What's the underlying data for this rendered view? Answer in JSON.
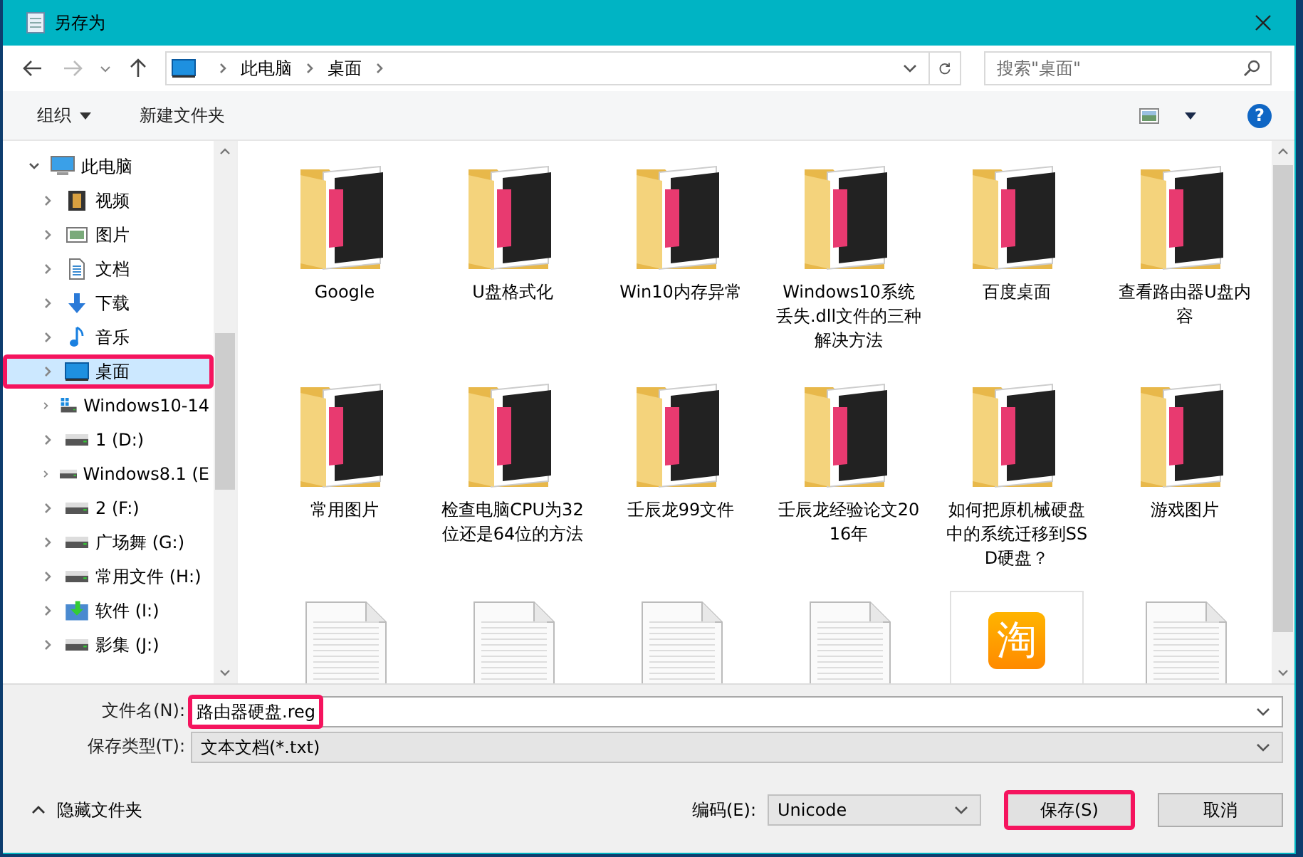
{
  "window": {
    "title": "另存为"
  },
  "address": {
    "path": [
      "此电脑",
      "桌面"
    ]
  },
  "search": {
    "placeholder": "搜索\"桌面\""
  },
  "toolbar": {
    "organize": "组织",
    "new_folder": "新建文件夹",
    "help": "?"
  },
  "sidebar": {
    "root": {
      "label": "此电脑",
      "expanded": true,
      "selected": false,
      "annotated": false
    },
    "items": [
      {
        "label": "视频",
        "kind": "video",
        "selected": false,
        "annotated": false
      },
      {
        "label": "图片",
        "kind": "pictures",
        "selected": false,
        "annotated": false
      },
      {
        "label": "文档",
        "kind": "docs",
        "selected": false,
        "annotated": false
      },
      {
        "label": "下载",
        "kind": "download",
        "selected": false,
        "annotated": false
      },
      {
        "label": "音乐",
        "kind": "music",
        "selected": false,
        "annotated": false
      },
      {
        "label": "桌面",
        "kind": "desktop",
        "selected": true,
        "annotated": true
      },
      {
        "label": "Windows10-14",
        "kind": "windrive",
        "selected": false,
        "annotated": false
      },
      {
        "label": "1 (D:)",
        "kind": "drive",
        "selected": false,
        "annotated": false
      },
      {
        "label": "Windows8.1 (E",
        "kind": "drive",
        "selected": false,
        "annotated": false
      },
      {
        "label": "2 (F:)",
        "kind": "drive",
        "selected": false,
        "annotated": false
      },
      {
        "label": "广场舞 (G:)",
        "kind": "drive",
        "selected": false,
        "annotated": false
      },
      {
        "label": "常用文件 (H:)",
        "kind": "drive",
        "selected": false,
        "annotated": false
      },
      {
        "label": "软件  (I:)",
        "kind": "softdrive",
        "selected": false,
        "annotated": false
      },
      {
        "label": "影集 (J:)",
        "kind": "drive",
        "selected": false,
        "annotated": false
      }
    ]
  },
  "files": [
    {
      "name": "Google",
      "kind": "folder"
    },
    {
      "name": "U盘格式化",
      "kind": "folder"
    },
    {
      "name": "Win10内存异常",
      "kind": "folder"
    },
    {
      "name": "Windows10系统丢失.dll文件的三种解决方法",
      "kind": "folder"
    },
    {
      "name": "百度桌面",
      "kind": "folder"
    },
    {
      "name": "查看路由器U盘内容",
      "kind": "folder"
    },
    {
      "name": "常用图片",
      "kind": "folder"
    },
    {
      "name": "检查电脑CPU为32位还是64位的方法",
      "kind": "folder"
    },
    {
      "name": "壬辰龙99文件",
      "kind": "folder"
    },
    {
      "name": "壬辰龙经验论文2016年",
      "kind": "folder"
    },
    {
      "name": "如何把原机械硬盘中的系统迁移到SSD硬盘？",
      "kind": "folder"
    },
    {
      "name": "游戏图片",
      "kind": "folder"
    },
    {
      "kind": "doc"
    },
    {
      "kind": "doc"
    },
    {
      "kind": "doc"
    },
    {
      "kind": "doc"
    },
    {
      "kind": "app",
      "logo": "淘"
    },
    {
      "kind": "doc"
    }
  ],
  "filename": {
    "label": "文件名(N):",
    "value": "路由器硬盘.reg",
    "annotated": true
  },
  "filetype": {
    "label": "保存类型(T):",
    "value": "文本文档(*.txt)"
  },
  "hide_folders": "隐藏文件夹",
  "encoding": {
    "label": "编码(E):",
    "value": "Unicode"
  },
  "buttons": [
    {
      "label": "保存(S)",
      "annotated": true
    },
    {
      "label": "取消",
      "annotated": false
    }
  ]
}
